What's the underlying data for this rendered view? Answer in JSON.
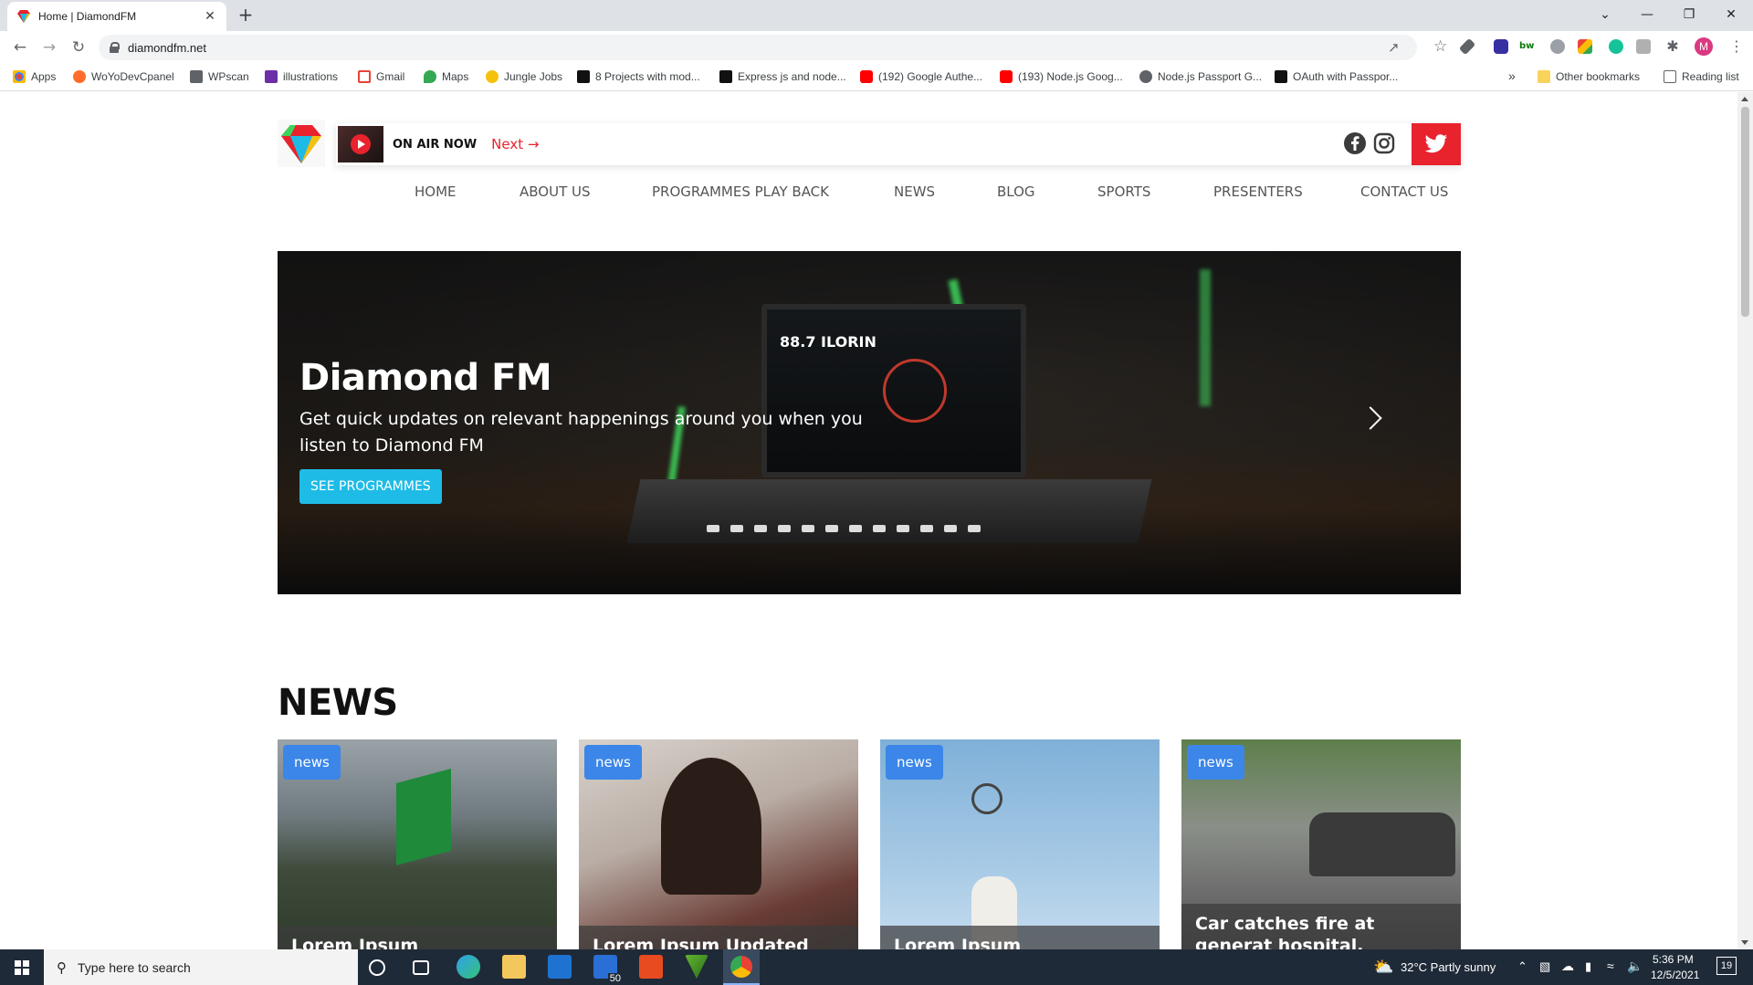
{
  "browser": {
    "tab_title": "Home | DiamondFM",
    "tab_close": "✕",
    "new_tab": "+",
    "url": "diamondfm.net",
    "window_controls": [
      "⌄",
      "—",
      "❐",
      "✕"
    ],
    "profile_initial": "M"
  },
  "bookmarks": [
    {
      "label": "Apps",
      "color": "#ea4335"
    },
    {
      "label": "WoYoDevCpanel",
      "color": "#ff6c2c"
    },
    {
      "label": "WPscan",
      "color": "#5f6368"
    },
    {
      "label": "illustrations",
      "color": "#6b2fa8"
    },
    {
      "label": "Gmail",
      "color": "#ea4335"
    },
    {
      "label": "Maps",
      "color": "#34a853"
    },
    {
      "label": "Jungle Jobs",
      "color": "#f4c20d"
    },
    {
      "label": "8 Projects with mod...",
      "color": "#111111"
    },
    {
      "label": "Express js and node...",
      "color": "#111111"
    },
    {
      "label": "(192) Google Authe...",
      "color": "#ff0000"
    },
    {
      "label": "(193) Node.js Goog...",
      "color": "#ff0000"
    },
    {
      "label": "Node.js Passport G...",
      "color": "#5f6368"
    },
    {
      "label": "OAuth with Passpor...",
      "color": "#111111"
    }
  ],
  "bookmarks_overflow": "»",
  "other_bookmarks": "Other bookmarks",
  "reading_list": "Reading list",
  "header": {
    "on_air_label": "ON AIR NOW",
    "next_label": "Next →",
    "accent_color": "#e8232e"
  },
  "nav": [
    "HOME",
    "ABOUT US",
    "PROGRAMMES PLAY BACK",
    "NEWS",
    "BLOG",
    "SPORTS",
    "PRESENTERS",
    "CONTACT US"
  ],
  "hero": {
    "frequency": "88.7 ILORIN",
    "title": "Diamond FM",
    "subtitle": "Get quick updates on relevant happenings around you when you listen to Diamond FM",
    "cta": "SEE PROGRAMMES",
    "cta_color": "#1ebbe6"
  },
  "news": {
    "section_title": "NEWS",
    "cards": [
      {
        "badge": "news",
        "title": "Lorem Ipsum"
      },
      {
        "badge": "news",
        "title": "Lorem Ipsum Updated"
      },
      {
        "badge": "news",
        "title": "Lorem Ipsum"
      },
      {
        "badge": "news",
        "title": "Car catches fire at generat hospital, Surulere, Ilorin"
      }
    ]
  },
  "taskbar": {
    "search_placeholder": "Type here to search",
    "mail_badge": "50",
    "weather": "32°C  Partly sunny",
    "time": "5:36 PM",
    "date": "12/5/2021",
    "notifications": "19"
  }
}
